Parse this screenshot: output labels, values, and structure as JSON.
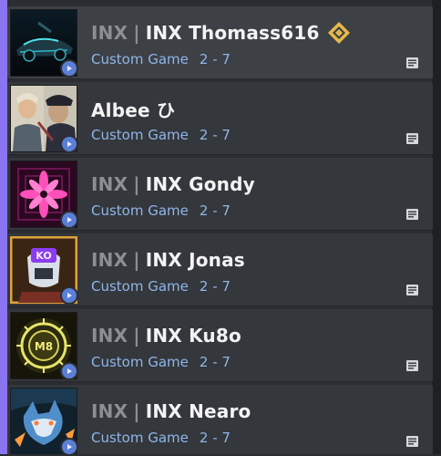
{
  "friends": [
    {
      "tag": "INX",
      "separator": "|",
      "name": "INX Thomass616",
      "status": "Custom Game",
      "score": "2 - 7",
      "has_rank": true,
      "has_tag": true,
      "avatar": "car-art"
    },
    {
      "tag": "",
      "separator": "",
      "name": "Albee ひ",
      "status": "Custom Game",
      "score": "2 - 7",
      "has_rank": false,
      "has_tag": false,
      "avatar": "agents-art"
    },
    {
      "tag": "INX",
      "separator": "|",
      "name": "INX Gondy",
      "status": "Custom Game",
      "score": "2 - 7",
      "has_rank": false,
      "has_tag": true,
      "avatar": "pink-star-art"
    },
    {
      "tag": "INX",
      "separator": "|",
      "name": "INX Jonas",
      "status": "Custom Game",
      "score": "2 - 7",
      "has_rank": false,
      "has_tag": true,
      "avatar": "ko-robot-art"
    },
    {
      "tag": "INX",
      "separator": "|",
      "name": "INX Ku8o",
      "status": "Custom Game",
      "score": "2 - 7",
      "has_rank": false,
      "has_tag": true,
      "avatar": "gold-emblem-art"
    },
    {
      "tag": "INX",
      "separator": "|",
      "name": "INX Nearo",
      "status": "Custom Game",
      "score": "2 - 7",
      "has_rank": false,
      "has_tag": true,
      "avatar": "wolf-art"
    }
  ],
  "colors": {
    "accent": "#8a74f0",
    "status_text": "#8fb6ea",
    "status_dot": "#5b7fd6",
    "tag_text": "#8b8e93",
    "rank_badge": "#e7b94a"
  },
  "icons": {
    "rank": "rank-diamond-icon",
    "note": "note-icon",
    "status": "in-game-play-icon"
  }
}
